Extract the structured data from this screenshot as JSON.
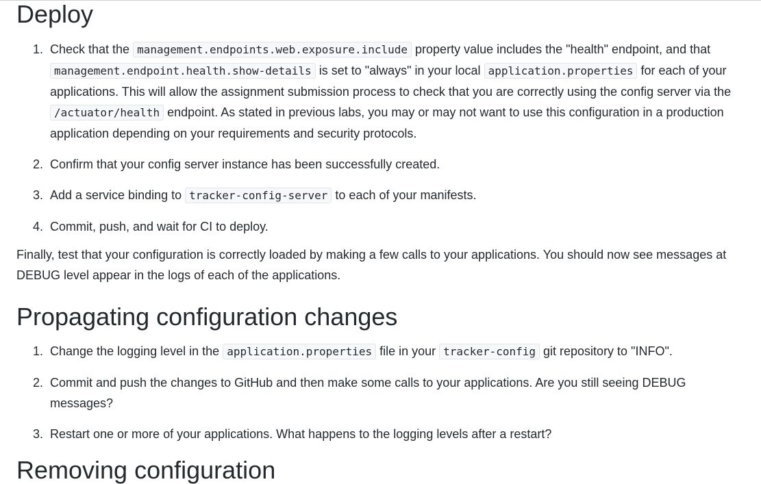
{
  "deploy": {
    "heading": "Deploy",
    "items": [
      {
        "num": "1.",
        "t1": "Check that the ",
        "c1": "management.endpoints.web.exposure.include",
        "t2": " property value includes the \"health\" endpoint, and that ",
        "c2": "management.endpoint.health.show-details",
        "t3": " is set to \"always\" in your local ",
        "c3": "application.properties",
        "t4": " for each of your applications. This will allow the assignment submission process to check that you are correctly using the config server via the ",
        "c4": "/actuator/health",
        "t5": " endpoint. As stated in previous labs, you may or may not want to use this configuration in a production application depending on your requirements and security protocols."
      },
      {
        "num": "2.",
        "text": "Confirm that your config server instance has been successfully created."
      },
      {
        "num": "3.",
        "t1": "Add a service binding to ",
        "c1": "tracker-config-server",
        "t2": " to each of your manifests."
      },
      {
        "num": "4.",
        "text": "Commit, push, and wait for CI to deploy."
      }
    ],
    "paragraph": "Finally, test that your configuration is correctly loaded by making a few calls to your applications. You should now see messages at DEBUG level appear in the logs of each of the applications."
  },
  "propagating": {
    "heading": "Propagating configuration changes",
    "items": [
      {
        "num": "1.",
        "t1": "Change the logging level in the ",
        "c1": "application.properties",
        "t2": " file in your ",
        "c2": "tracker-config",
        "t3": " git repository to \"INFO\"."
      },
      {
        "num": "2.",
        "text": "Commit and push the changes to GitHub and then make some calls to your applications. Are you still seeing DEBUG messages?"
      },
      {
        "num": "3.",
        "text": "Restart one or more of your applications. What happens to the logging levels after a restart?"
      }
    ]
  },
  "next_heading_partial": "Removing configuration"
}
